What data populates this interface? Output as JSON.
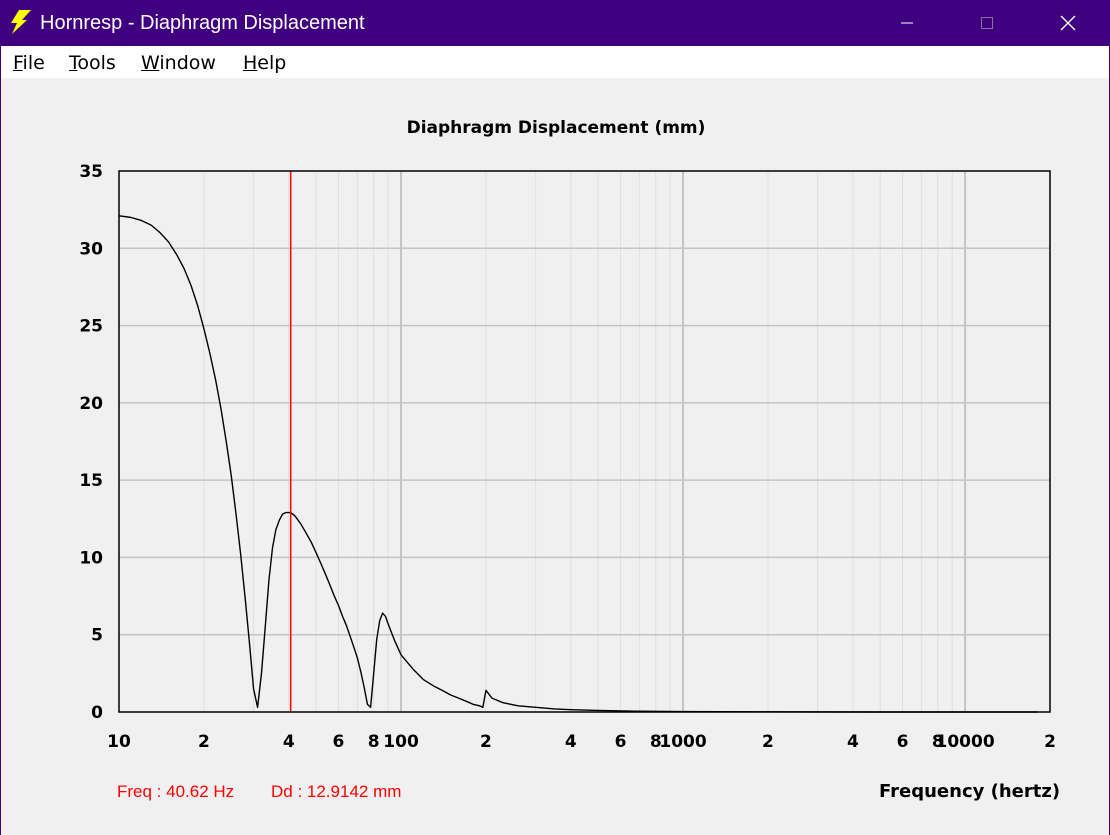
{
  "window": {
    "title": "Hornresp - Diaphragm Displacement",
    "titlebar_color": "#3f007f"
  },
  "menu": [
    {
      "label": "File",
      "accel": "F",
      "rest": "ile"
    },
    {
      "label": "Tools",
      "accel": "T",
      "rest": "ools"
    },
    {
      "label": "Window",
      "accel": "W",
      "rest": "indow"
    },
    {
      "label": "Help",
      "accel": "H",
      "rest": "elp"
    }
  ],
  "status": {
    "freq": "Freq : 40.62 Hz",
    "dd": "Dd : 12.9142 mm"
  },
  "chart_data": {
    "type": "line",
    "title": "Diaphragm Displacement (mm)",
    "xlabel": "Frequency (hertz)",
    "ylabel": "",
    "x_scale": "log",
    "xlim": [
      10,
      20000
    ],
    "ylim": [
      0,
      35
    ],
    "y_ticks": [
      0,
      5,
      10,
      15,
      20,
      25,
      30,
      35
    ],
    "x_ticks": [
      {
        "value": 10,
        "label": "10"
      },
      {
        "value": 20,
        "label": "2"
      },
      {
        "value": 40,
        "label": "4"
      },
      {
        "value": 60,
        "label": "6"
      },
      {
        "value": 80,
        "label": "8"
      },
      {
        "value": 100,
        "label": "100"
      },
      {
        "value": 200,
        "label": "2"
      },
      {
        "value": 400,
        "label": "4"
      },
      {
        "value": 600,
        "label": "6"
      },
      {
        "value": 800,
        "label": "8"
      },
      {
        "value": 1000,
        "label": "1000"
      },
      {
        "value": 2000,
        "label": "2"
      },
      {
        "value": 4000,
        "label": "4"
      },
      {
        "value": 6000,
        "label": "6"
      },
      {
        "value": 8000,
        "label": "8"
      },
      {
        "value": 10000,
        "label": "10000"
      },
      {
        "value": 20000,
        "label": "2"
      }
    ],
    "grid": true,
    "cursor": {
      "x": 40.62,
      "y": 12.9142,
      "color": "#ff0000"
    },
    "line_color": "#000000",
    "series": [
      {
        "x": [
          10,
          11,
          12,
          13,
          14,
          15,
          16,
          17,
          18,
          19,
          20,
          21,
          22,
          23,
          24,
          25,
          26,
          27,
          28,
          29,
          30,
          31,
          32,
          33,
          34,
          35,
          36,
          37,
          38,
          39,
          40,
          40.62,
          42,
          44,
          46,
          48,
          50,
          52,
          54,
          56,
          58,
          60,
          62,
          64,
          66,
          68,
          70,
          72,
          74,
          76,
          78,
          80,
          82,
          84,
          86,
          88,
          90,
          95,
          100,
          110,
          120,
          130,
          140,
          150,
          160,
          170,
          180,
          190,
          195,
          200,
          210,
          230,
          260,
          300,
          350,
          400,
          500,
          700,
          1000,
          2000,
          5000,
          10000,
          18000
        ],
        "y": [
          32.1,
          32.0,
          31.8,
          31.5,
          31.0,
          30.4,
          29.6,
          28.7,
          27.6,
          26.3,
          24.8,
          23.2,
          21.5,
          19.6,
          17.5,
          15.3,
          12.8,
          10.2,
          7.4,
          4.5,
          1.5,
          0.3,
          2.5,
          5.5,
          8.5,
          10.6,
          11.8,
          12.4,
          12.8,
          12.9,
          12.9,
          12.9,
          12.7,
          12.2,
          11.6,
          11.0,
          10.3,
          9.6,
          8.9,
          8.2,
          7.5,
          6.9,
          6.2,
          5.6,
          4.9,
          4.2,
          3.5,
          2.6,
          1.6,
          0.5,
          0.3,
          2.5,
          4.7,
          5.9,
          6.4,
          6.2,
          5.7,
          4.6,
          3.7,
          2.8,
          2.1,
          1.7,
          1.4,
          1.1,
          0.9,
          0.7,
          0.5,
          0.4,
          0.3,
          1.4,
          0.9,
          0.6,
          0.4,
          0.3,
          0.2,
          0.15,
          0.1,
          0.05,
          0.03,
          0.01,
          0.0,
          0.0,
          0.0
        ]
      }
    ]
  }
}
